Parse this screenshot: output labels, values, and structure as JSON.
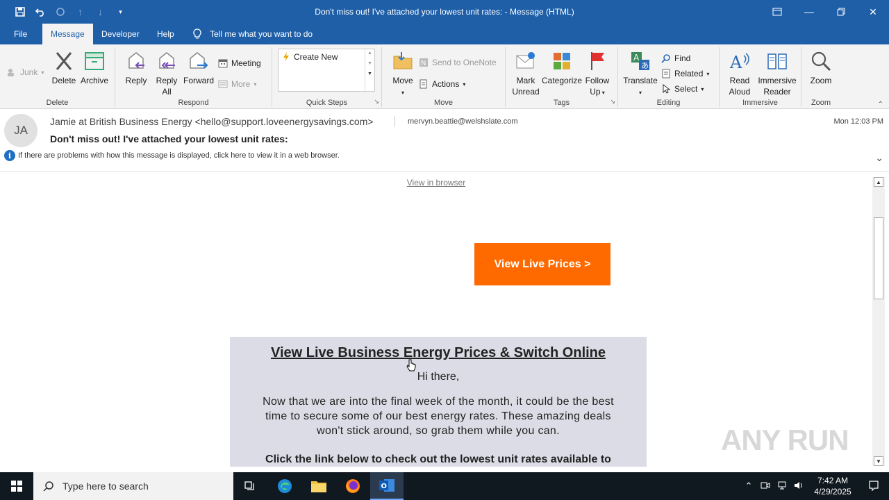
{
  "window": {
    "title": "Don't miss out! I've attached your lowest unit rates:  -  Message (HTML)"
  },
  "tabs": [
    {
      "label": "File"
    },
    {
      "label": "Message"
    },
    {
      "label": "Developer"
    },
    {
      "label": "Help"
    }
  ],
  "tellme": "Tell me what you want to do",
  "ribbon": {
    "delete_group": {
      "label": "Delete",
      "junk": "Junk",
      "delete": "Delete",
      "archive": "Archive"
    },
    "respond_group": {
      "label": "Respond",
      "reply": "Reply",
      "reply_all_1": "Reply",
      "reply_all_2": "All",
      "forward": "Forward",
      "meeting": "Meeting",
      "more": "More"
    },
    "quicksteps_group": {
      "label": "Quick Steps",
      "create_new": "Create New"
    },
    "move_group": {
      "label": "Move",
      "move": "Move",
      "onenote": "Send to OneNote",
      "actions": "Actions"
    },
    "tags_group": {
      "label": "Tags",
      "mark_unread_1": "Mark",
      "mark_unread_2": "Unread",
      "categorize": "Categorize",
      "followup_1": "Follow",
      "followup_2": "Up"
    },
    "editing_group": {
      "label": "Editing",
      "translate": "Translate",
      "find": "Find",
      "related": "Related",
      "select": "Select"
    },
    "immersive_group": {
      "label": "Immersive",
      "read_aloud_1": "Read",
      "read_aloud_2": "Aloud",
      "immersive_reader_1": "Immersive",
      "immersive_reader_2": "Reader"
    },
    "zoom_group": {
      "label": "Zoom",
      "zoom": "Zoom"
    }
  },
  "message": {
    "avatar_initials": "JA",
    "sender": "Jamie at British Business Energy <hello@support.loveenergysavings.com>",
    "recipient": "mervyn.beattie@welshslate.com",
    "date": "Mon 12:03 PM",
    "subject": "Don't miss out! I've attached your lowest unit rates:",
    "infobar": "If there are problems with how this message is displayed, click here to view it in a web browser."
  },
  "body": {
    "view_in_browser": "View in browser",
    "cta": "View Live Prices >",
    "card_heading": "View Live Business Energy Prices & Switch Online",
    "greeting": "Hi there,",
    "paragraph": "Now that we are into the final week of the month, it could be the best time to secure some of our best energy rates. These amazing deals won't stick around, so grab them while you can.",
    "bold_line": "Click the link below to check out the lowest unit rates available to"
  },
  "watermark": "ANY RUN",
  "taskbar": {
    "search_placeholder": "Type here to search",
    "time": "7:42 AM",
    "date": "4/29/2025"
  },
  "colors": {
    "titlebar": "#1f5fa8",
    "cta": "#ff6a00",
    "card": "#dcdce6"
  }
}
